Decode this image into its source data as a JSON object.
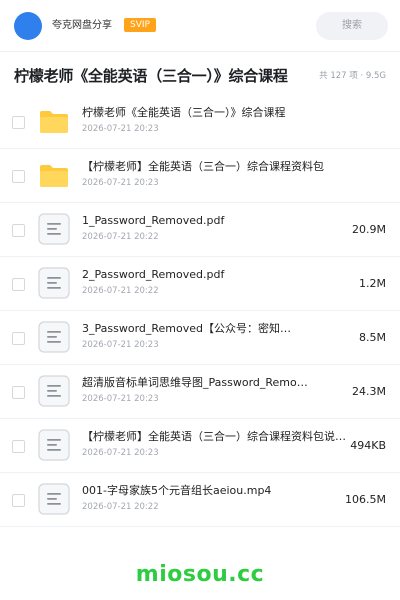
{
  "header": {
    "username": "夸克网盘分享",
    "vip_label": "SVIP",
    "search_placeholder": "搜索"
  },
  "title": {
    "text": "柠檬老师《全能英语（三合一）》综合课程",
    "summary": "共 127 项 · 9.5G"
  },
  "files": [
    {
      "type": "folder",
      "name": "柠檬老师《全能英语（三合一）》综合课程",
      "date": "2026-07-21 20:23",
      "size": ""
    },
    {
      "type": "folder",
      "name": "【柠檬老师】全能英语（三合一）综合课程资料包",
      "date": "2026-07-21 20:23",
      "size": ""
    },
    {
      "type": "file",
      "name": "1_Password_Removed.pdf",
      "date": "2026-07-21 20:22",
      "size": "20.9M"
    },
    {
      "type": "file",
      "name": "2_Password_Removed.pdf",
      "date": "2026-07-21 20:22",
      "size": "1.2M"
    },
    {
      "type": "file",
      "name": "3_Password_Removed【公众号：密知…",
      "date": "2026-07-21 20:23",
      "size": "8.5M"
    },
    {
      "type": "file",
      "name": "超清版音标单词思维导图_Password_Remo…",
      "date": "2026-07-21 20:23",
      "size": "24.3M"
    },
    {
      "type": "file",
      "name": "【柠檬老师】全能英语（三合一）综合课程资料包说明…",
      "date": "2026-07-21 20:23",
      "size": "494KB"
    },
    {
      "type": "file",
      "name": "001-字母家族5个元音组长aeiou.mp4",
      "date": "2026-07-21 20:22",
      "size": "106.5M"
    }
  ],
  "watermark": "miosou.cc",
  "colors": {
    "accent_blue": "#2f80ed",
    "vip_orange": "#ffa31a",
    "folder_yellow": "#ffc93c",
    "watermark_green": "#2ecc40"
  }
}
